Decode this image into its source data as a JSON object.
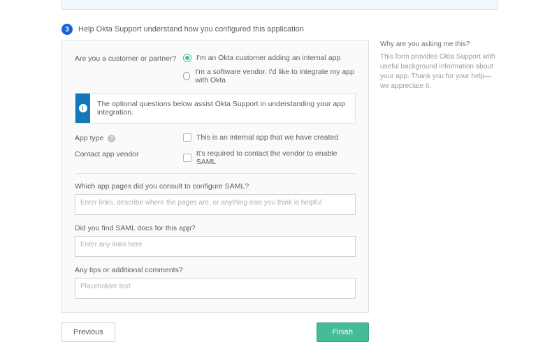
{
  "step": {
    "number": "3",
    "title": "Help Okta Support understand how you configured this application"
  },
  "form": {
    "customer_q": "Are you a customer or partner?",
    "radio_customer": "I'm an Okta customer adding an internal app",
    "radio_vendor": "I'm a software vendor. I'd like to integrate my app with Okta",
    "info_banner": "The optional questions below assist Okta Support in understanding your app integration.",
    "app_type_label": "App type",
    "app_type_check": "This is an internal app that we have created",
    "contact_label": "Contact app vendor",
    "contact_check": "It's required to contact the vendor to enable SAML",
    "q_pages": "Which app pages did you consult to configure SAML?",
    "q_pages_ph": "Enter links, describe where the pages are, or anything else you think is helpful",
    "q_docs": "Did you find SAML docs for this app?",
    "q_docs_ph": "Enter any links here",
    "q_tips": "Any tips or additional comments?",
    "q_tips_ph": "Placeholder text"
  },
  "aside": {
    "title": "Why are you asking me this?",
    "body": "This form provides Okta Support with useful background information about your app. Thank you for your help—we appreciate it."
  },
  "buttons": {
    "previous": "Previous",
    "finish": "Finish"
  }
}
